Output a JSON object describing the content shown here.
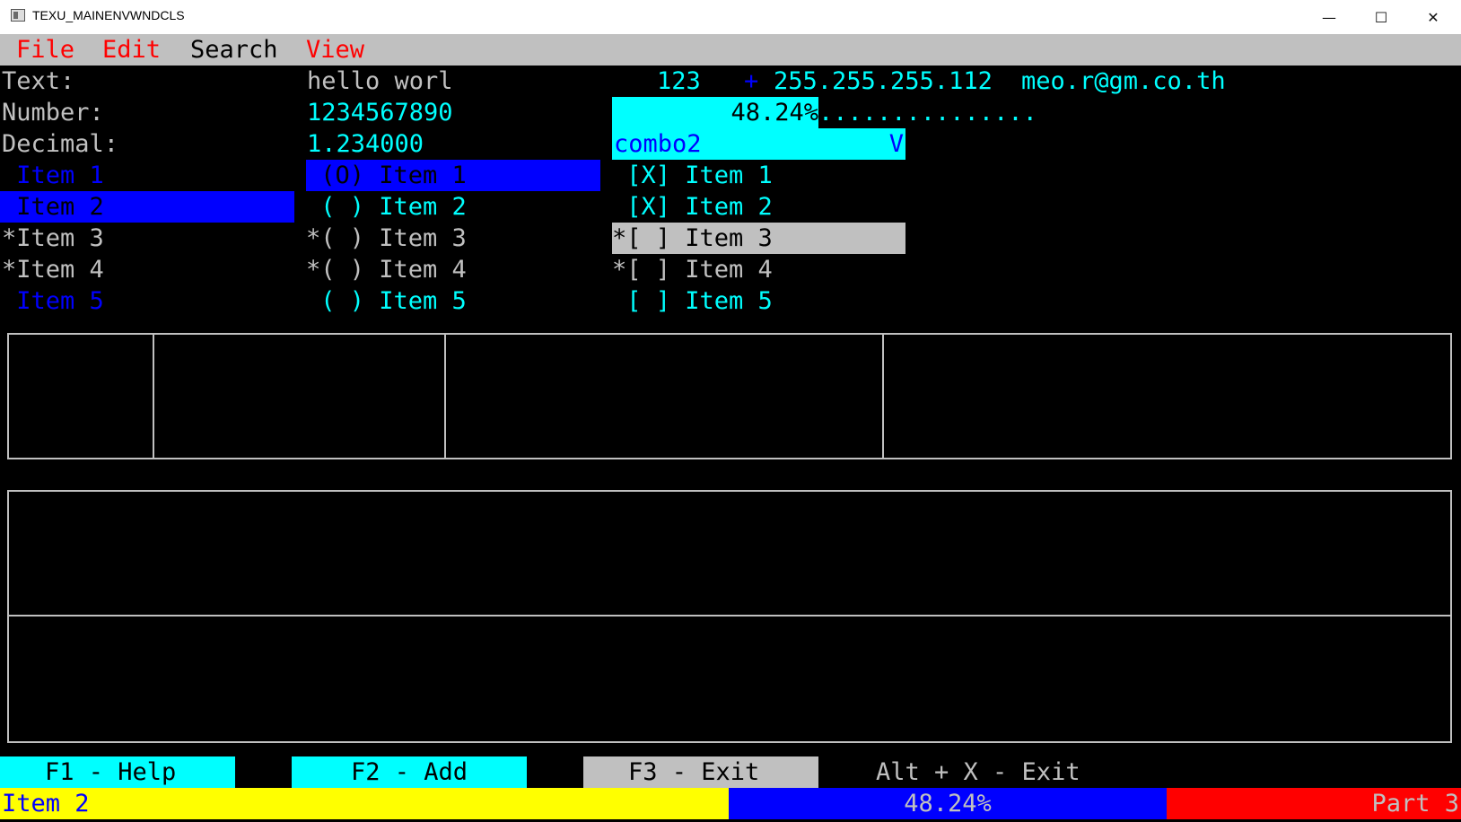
{
  "window": {
    "title": "TEXU_MAINENVWNDCLS",
    "minimize_glyph": "—",
    "maximize_glyph": "☐",
    "close_glyph": "✕"
  },
  "menu": {
    "file": "File",
    "edit": "Edit",
    "search": "Search",
    "view": "View"
  },
  "form": {
    "text_label": "Text:",
    "number_label": "Number:",
    "decimal_label": "Decimal:",
    "text_value": "hello worl",
    "number_value": "1234567890",
    "decimal_value": "1.234000",
    "field_123": "123",
    "plus_sign": "+",
    "ip_address": "255.255.255.112",
    "email": "meo.r@gm.co.th",
    "progress_text": "48.24%",
    "progress_fraction": 0.4824,
    "progress_dots": "...............",
    "combo_value": "combo2",
    "combo_arrow": "V"
  },
  "listbox": [
    " Item 1",
    " Item 2",
    "*Item 3",
    "*Item 4",
    " Item 5"
  ],
  "radios": [
    " (O) Item 1",
    " ( ) Item 2",
    "*( ) Item 3",
    "*( ) Item 4",
    " ( ) Item 5"
  ],
  "checks": [
    " [X] Item 1",
    " [X] Item 2",
    "*[ ] Item 3",
    "*[ ] Item 4",
    " [ ] Item 5"
  ],
  "fkeys": {
    "f1": "F1 - Help",
    "f2": "F2 - Add",
    "f3": "F3 - Exit",
    "altx": "Alt + X - Exit"
  },
  "status": {
    "part1": "Item 2",
    "part2": "48.24%",
    "part3": "Part 3"
  },
  "colors": {
    "cyan": "#00ffff",
    "blue": "#0000ff",
    "red": "#ff0000",
    "yellow": "#ffff00",
    "grey": "#c0c0c0",
    "black": "#000000",
    "white": "#ffffff"
  }
}
